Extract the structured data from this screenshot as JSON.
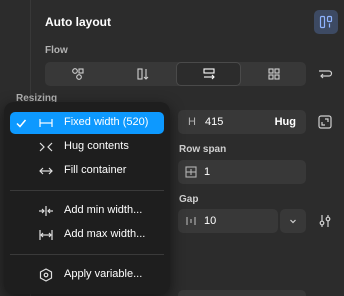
{
  "panel": {
    "title": "Auto layout",
    "flow_label": "Flow",
    "resizing_label": "Resizing"
  },
  "height_field": {
    "prefix": "H",
    "value": "415",
    "mode": "Hug"
  },
  "row_span": {
    "label": "Row span",
    "value": "1"
  },
  "gap": {
    "label": "Gap",
    "value": "10"
  },
  "menu": {
    "items": [
      {
        "label": "Fixed width (520)",
        "icon": "fixed-width-icon",
        "selected": true
      },
      {
        "label": "Hug contents",
        "icon": "hug-contents-icon",
        "selected": false
      },
      {
        "label": "Fill container",
        "icon": "fill-container-icon",
        "selected": false
      },
      {
        "label": "Add min width...",
        "icon": "min-width-icon",
        "selected": false
      },
      {
        "label": "Add max width...",
        "icon": "max-width-icon",
        "selected": false
      },
      {
        "label": "Apply variable...",
        "icon": "variable-icon",
        "selected": false
      }
    ]
  },
  "colors": {
    "background": "#2c2c2c",
    "menu_background": "#1e1e1e",
    "selected": "#0d99ff",
    "field": "#383838",
    "toggle_active": "#3d4a63"
  }
}
